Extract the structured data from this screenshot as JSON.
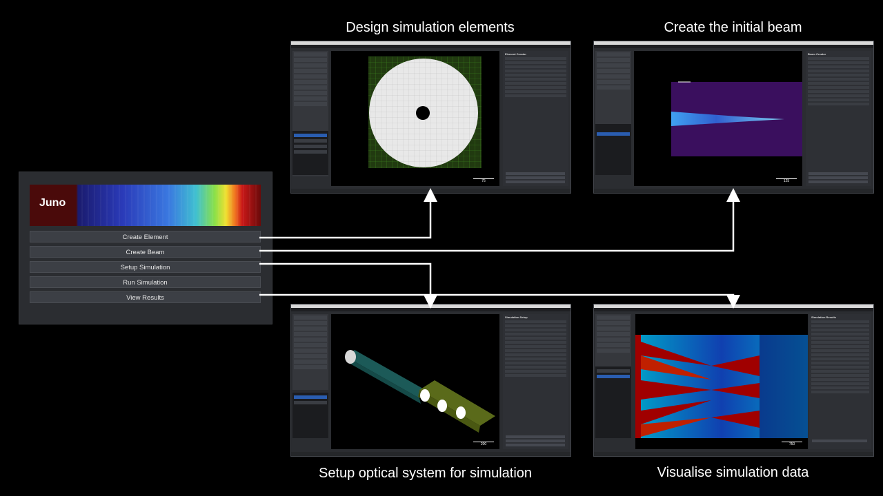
{
  "captions": {
    "design": "Design simulation elements",
    "beam": "Create the initial beam",
    "setup": "Setup optical system for simulation",
    "visualise": "Visualise simulation data"
  },
  "launcher": {
    "logo": "Juno",
    "buttons": [
      "Create Element",
      "Create Beam",
      "Setup Simulation",
      "Run Simulation",
      "View Results"
    ]
  },
  "windows": {
    "element": {
      "panel_title": "Element Creator",
      "scale": "75"
    },
    "beam": {
      "panel_title": "Beam Creator",
      "scale": "125"
    },
    "setup": {
      "panel_title": "Simulation Setup",
      "scale": "200"
    },
    "results": {
      "panel_title": "Simulation Results",
      "scale": "750"
    }
  },
  "colors": {
    "arrow": "#ffffff",
    "button_bg": "#3c3f45",
    "window_bg": "#2b2d31",
    "selected_layer": "#2a5db0"
  }
}
